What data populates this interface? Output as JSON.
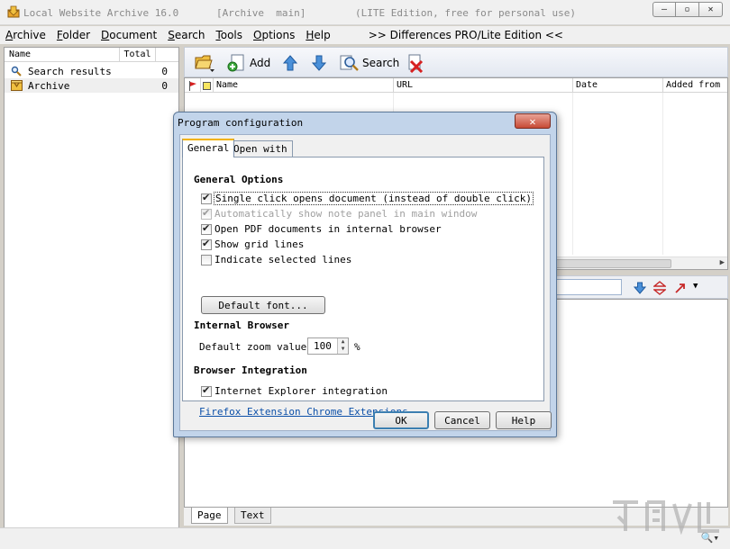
{
  "window": {
    "app_title": "Local Website Archive 16.0",
    "archive_label": "[Archive  main]",
    "edition": "(LITE Edition, free for personal use)",
    "controls": {
      "minimize": "—",
      "maximize": "▫",
      "close": "✕"
    }
  },
  "menu": {
    "items": [
      {
        "first": "A",
        "rest": "rchive"
      },
      {
        "first": "F",
        "rest": "older"
      },
      {
        "first": "D",
        "rest": "ocument"
      },
      {
        "first": "S",
        "rest": "earch"
      },
      {
        "first": "T",
        "rest": "ools"
      },
      {
        "first": "O",
        "rest": "ptions"
      },
      {
        "first": "H",
        "rest": "elp"
      }
    ],
    "differences": ">> Differences PRO/Lite Edition <<"
  },
  "left_panel": {
    "header": {
      "name": "Name",
      "total": "Total"
    },
    "rows": [
      {
        "label": "Search results",
        "count": "0",
        "icon": "magnifier-icon"
      },
      {
        "label": "Archive",
        "count": "0",
        "icon": "archive-box-icon"
      }
    ]
  },
  "toolbar": {
    "add_label": "Add",
    "search_label": "Search"
  },
  "list": {
    "columns": {
      "name": "Name",
      "url": "URL",
      "date": "Date",
      "added_from": "Added from"
    }
  },
  "bottom_tabs": {
    "page": "Page",
    "text": "Text"
  },
  "dialog": {
    "title": "Program configuration",
    "close": "✕",
    "tabs": {
      "general": "General",
      "open_with": "Open with"
    },
    "general_options": {
      "heading": "General Options",
      "options": [
        {
          "label": "Single click opens document (instead of double click)",
          "checked": true
        },
        {
          "label": "Automatically show note panel in main window",
          "checked": true,
          "disabled": true
        },
        {
          "label": "Open PDF documents in internal browser",
          "checked": true
        },
        {
          "label": "Show grid lines",
          "checked": true
        },
        {
          "label": "Indicate selected lines",
          "checked": false
        }
      ],
      "font_button": "Default font..."
    },
    "internal_browser": {
      "heading": "Internal Browser",
      "zoom_label": "Default zoom value:",
      "zoom_value": "100",
      "zoom_unit": "%"
    },
    "browser_integration": {
      "heading": "Browser Integration",
      "ie_label": "Internet Explorer integration",
      "ie_checked": true,
      "extensions_link": "Firefox Extension Chrome Extensions..."
    },
    "buttons": {
      "ok": "OK",
      "cancel": "Cancel",
      "help": "Help"
    }
  },
  "colors": {
    "accent": "#3c7fb1",
    "link": "#0b4fa8",
    "delete_red": "#d62020"
  }
}
